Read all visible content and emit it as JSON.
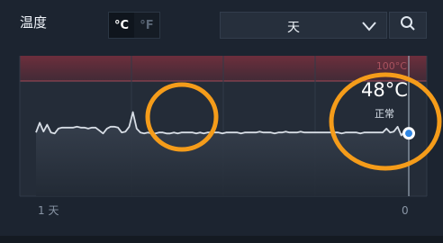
{
  "header": {
    "title": "温度",
    "unit_celsius": "°C",
    "unit_fahrenheit": "°F",
    "active_unit": "°C"
  },
  "range": {
    "selected": "天"
  },
  "chart_data": {
    "type": "line",
    "upper_label": "100°C",
    "current_value": "48°C",
    "status": "正常",
    "x_tick_left": "1 天",
    "x_tick_right": "0",
    "series_color": "#d7dde5",
    "threshold_color": "#8a3a48",
    "marker_color": "#2f86e4",
    "annotation_color": "#f59c1a",
    "ylim": [
      0,
      100
    ],
    "x": [
      0,
      1,
      2,
      3,
      4,
      5,
      6,
      7,
      8,
      9,
      10,
      11,
      12,
      13,
      14,
      15,
      16,
      17,
      18,
      19,
      20,
      21,
      22,
      23,
      24,
      25,
      26,
      27,
      28,
      29,
      30,
      31,
      32,
      33,
      34,
      35,
      36,
      37,
      38,
      39,
      40,
      41,
      42,
      43,
      44,
      45,
      46,
      47,
      48,
      49,
      50,
      51,
      52,
      53,
      54,
      55,
      56,
      57,
      58,
      59,
      60,
      61,
      62,
      63,
      64,
      65,
      66,
      67,
      68,
      69,
      70,
      71,
      72,
      73,
      74,
      75,
      76,
      77,
      78,
      79,
      80,
      81,
      82,
      83,
      84,
      85,
      86,
      87,
      88,
      89,
      90,
      91,
      92,
      93,
      94,
      95,
      96,
      97,
      98,
      99,
      100
    ],
    "y": [
      47,
      57,
      48,
      55,
      47,
      46,
      51,
      52,
      52,
      52,
      52,
      53,
      52,
      52,
      51,
      52,
      52,
      49,
      46,
      51,
      53,
      53,
      52,
      47,
      48,
      53,
      68,
      51,
      47,
      46,
      47,
      46,
      46,
      47,
      47,
      46,
      46,
      47,
      46,
      47,
      47,
      47,
      47,
      46,
      47,
      46,
      47,
      47,
      47,
      47,
      46,
      47,
      47,
      47,
      47,
      46,
      47,
      47,
      47,
      47,
      48,
      47,
      47,
      47,
      46,
      47,
      47,
      48,
      47,
      47,
      47,
      48,
      47,
      47,
      47,
      47,
      47,
      47,
      47,
      47,
      47,
      47,
      46,
      47,
      47,
      47,
      47,
      46,
      47,
      47,
      47,
      47,
      47,
      47,
      51,
      47,
      48,
      53,
      44,
      49,
      48
    ]
  }
}
